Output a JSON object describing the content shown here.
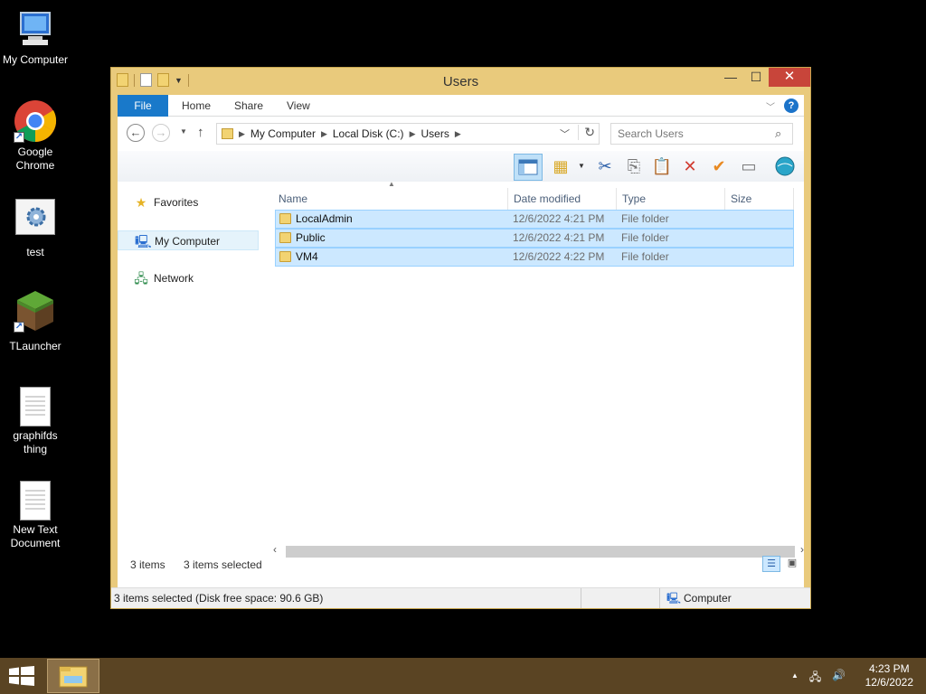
{
  "desktop": {
    "icons": [
      {
        "label": "My Computer"
      },
      {
        "label": "Google Chrome"
      },
      {
        "label": "test"
      },
      {
        "label": "TLauncher"
      },
      {
        "label": "graphifds thing"
      },
      {
        "label": "New Text Document"
      }
    ]
  },
  "window": {
    "title": "Users",
    "controls": {
      "minimize": "—",
      "maximize": "☐",
      "close": "✕"
    },
    "ribbon_tabs": [
      "File",
      "Home",
      "Share",
      "View"
    ],
    "help_label": "?",
    "address": {
      "segments": [
        "My Computer",
        "Local Disk (C:)",
        "Users"
      ]
    },
    "search_placeholder": "Search Users",
    "nav_pane": {
      "items": [
        "Favorites",
        "My Computer",
        "Network"
      ]
    },
    "columns": [
      "Name",
      "Date modified",
      "Type",
      "Size"
    ],
    "files": [
      {
        "name": "LocalAdmin",
        "date": "12/6/2022 4:21 PM",
        "type": "File folder"
      },
      {
        "name": "Public",
        "date": "12/6/2022 4:21 PM",
        "type": "File folder"
      },
      {
        "name": "VM4",
        "date": "12/6/2022 4:22 PM",
        "type": "File folder"
      }
    ],
    "info": {
      "count": "3 items",
      "selected": "3 items selected"
    },
    "status": {
      "text": "3 items selected (Disk free space: 90.6 GB)",
      "location": "Computer"
    }
  },
  "taskbar": {
    "time": "4:23 PM",
    "date": "12/6/2022"
  },
  "colors": {
    "accent": "#1979ca",
    "window_frame": "#e9ca7c",
    "selection": "#cce8ff",
    "taskbar": "#5a4423",
    "close": "#c8453a"
  }
}
